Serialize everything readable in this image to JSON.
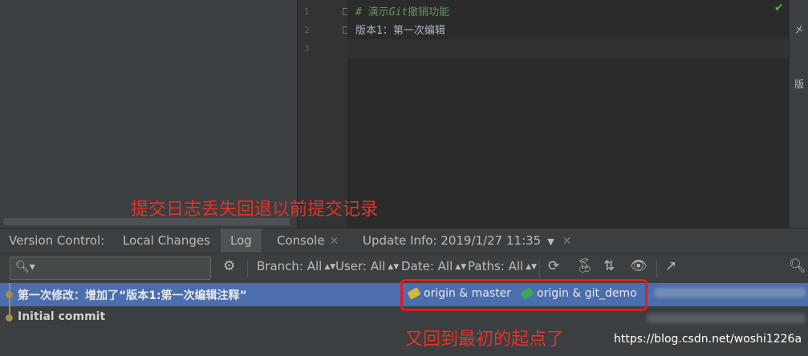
{
  "editor": {
    "line_numbers": [
      "1",
      "2",
      "3"
    ],
    "lines": [
      {
        "prefix": "# 演示",
        "italic": "Git",
        "suffix": "撤销功能"
      },
      {
        "text": "版本1：第一次编辑"
      },
      {
        "text": ""
      }
    ],
    "right_strip_marks": [
      "㐅",
      "版"
    ]
  },
  "annotations": {
    "top": "提交日志丢失回退以前提交记录",
    "bottom": "又回到最初的起点了"
  },
  "tool_window": {
    "tabs": {
      "version_control": "Version Control:",
      "local_changes": "Local Changes",
      "log": "Log",
      "console": "Console",
      "update_info": "Update Info: 2019/1/27 11:35"
    }
  },
  "toolbar": {
    "search_placeholder": "",
    "branch": "Branch: All",
    "user": "User: All",
    "date": "Date: All",
    "paths": "Paths: All"
  },
  "log": {
    "commits": [
      {
        "message": "第一次修改：增加了“版本1:第一次编辑注释”",
        "refs": [
          "origin & master",
          "origin & git_demo"
        ],
        "ref_colors": [
          "#d4b83a",
          "#3fa35a"
        ]
      },
      {
        "message": "Initial commit",
        "refs": []
      }
    ]
  },
  "watermark": "https://blog.csdn.net/woshi1226a",
  "colors": {
    "selection": "#4b6eaf",
    "annotation_red": "#e0342a",
    "highlight_box": "#e21b1b",
    "commit_graph": "#a88c4a"
  }
}
